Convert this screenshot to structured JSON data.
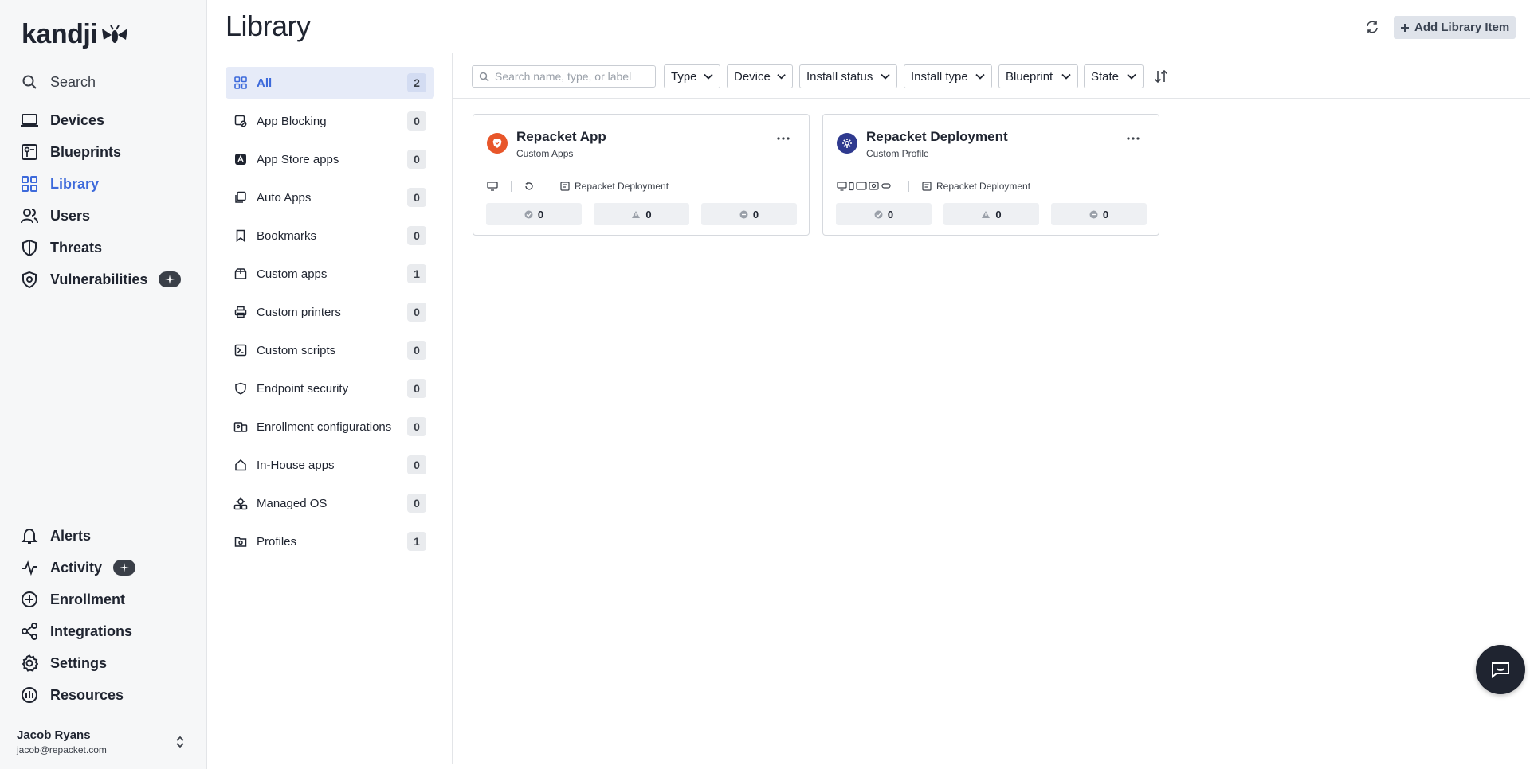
{
  "app": {
    "logo_text": "kandji",
    "accent": "#3d6adb"
  },
  "nav": {
    "search_label": "Search",
    "primary": [
      {
        "label": "Devices",
        "icon": "laptop-icon"
      },
      {
        "label": "Blueprints",
        "icon": "blueprint-icon"
      },
      {
        "label": "Library",
        "icon": "grid-icon",
        "active": true
      },
      {
        "label": "Users",
        "icon": "users-icon"
      },
      {
        "label": "Threats",
        "icon": "shield-icon"
      },
      {
        "label": "Vulnerabilities",
        "icon": "vulnerability-icon",
        "badge": "ai-sparkle-icon"
      }
    ],
    "secondary": [
      {
        "label": "Alerts",
        "icon": "bell-icon"
      },
      {
        "label": "Activity",
        "icon": "activity-icon",
        "badge": "ai-sparkle-icon"
      },
      {
        "label": "Enrollment",
        "icon": "plus-circle-icon"
      },
      {
        "label": "Integrations",
        "icon": "integrations-icon"
      },
      {
        "label": "Settings",
        "icon": "gear-icon"
      },
      {
        "label": "Resources",
        "icon": "resources-icon"
      }
    ],
    "user": {
      "name": "Jacob Ryans",
      "email": "jacob@repacket.com"
    }
  },
  "header": {
    "title": "Library",
    "add_label": "Add Library Item"
  },
  "categories": [
    {
      "label": "All",
      "count": "2",
      "active": true
    },
    {
      "label": "App Blocking",
      "count": "0"
    },
    {
      "label": "App Store apps",
      "count": "0"
    },
    {
      "label": "Auto Apps",
      "count": "0"
    },
    {
      "label": "Bookmarks",
      "count": "0"
    },
    {
      "label": "Custom apps",
      "count": "1"
    },
    {
      "label": "Custom printers",
      "count": "0"
    },
    {
      "label": "Custom scripts",
      "count": "0"
    },
    {
      "label": "Endpoint security",
      "count": "0"
    },
    {
      "label": "Enrollment configurations",
      "count": "0"
    },
    {
      "label": "In-House apps",
      "count": "0"
    },
    {
      "label": "Managed OS",
      "count": "0"
    },
    {
      "label": "Profiles",
      "count": "1"
    }
  ],
  "filters": {
    "search_placeholder": "Search name, type, or label",
    "dropdowns": [
      "Type",
      "Device",
      "Install status",
      "Install type",
      "Blueprint",
      "State"
    ]
  },
  "cards": [
    {
      "title": "Repacket App",
      "subtitle": "Custom Apps",
      "icon_color": "#e8562a",
      "blueprint": "Repacket Deployment",
      "stats": [
        "0",
        "0",
        "0"
      ]
    },
    {
      "title": "Repacket Deployment",
      "subtitle": "Custom Profile",
      "icon_color": "#2f3a8f",
      "blueprint": "Repacket Deployment",
      "stats": [
        "0",
        "0",
        "0"
      ]
    }
  ]
}
